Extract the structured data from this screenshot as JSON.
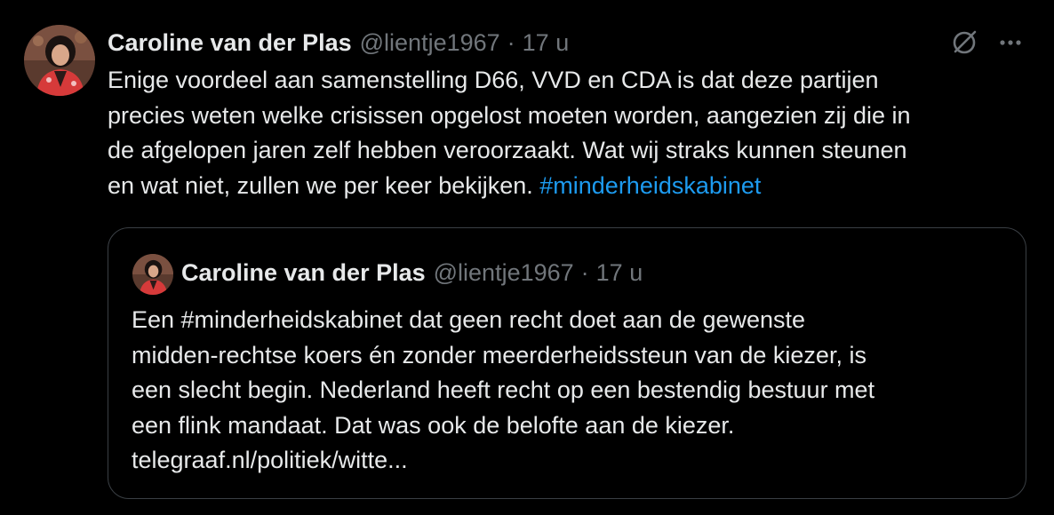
{
  "tweet": {
    "author_name": "Caroline van der Plas",
    "handle": "@lientje1967",
    "separator": "·",
    "time": "17 u",
    "text": "Enige voordeel aan samenstelling D66, VVD en CDA is dat deze partijen\nprecies weten welke crisissen opgelost moeten worden, aangezien zij die in\nde afgelopen jaren zelf hebben veroorzaakt. Wat wij straks kunnen steunen\nen wat niet, zullen we per keer bekijken. ",
    "hashtag": "#minderheidskabinet",
    "icons": [
      "grok-icon",
      "more-options-icon"
    ]
  },
  "quoted_tweet": {
    "author_name": "Caroline van der Plas",
    "handle": "@lientje1967",
    "separator": "·",
    "time": "17 u",
    "text": "Een #minderheidskabinet dat geen recht doet aan de gewenste\nmidden-rechtse koers én zonder meerderheidssteun van de kiezer, is\neen slecht begin. Nederland heeft recht op een bestendig bestuur met\neen flink mandaat. Dat was ook de belofte aan de kiezer.\n",
    "link": "telegraaf.nl/politiek/witte..."
  },
  "colors": {
    "background": "#000000",
    "text": "#e7e9ea",
    "muted": "#71767b",
    "link": "#1d9bf0",
    "border": "#3a3f44"
  }
}
